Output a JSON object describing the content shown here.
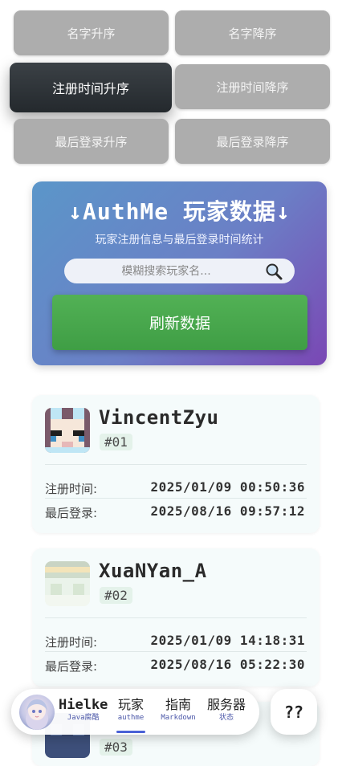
{
  "sort": {
    "name_asc": "名字升序",
    "name_desc": "名字降序",
    "reg_asc": "注册时间升序",
    "reg_desc": "注册时间降序",
    "login_asc": "最后登录升序",
    "login_desc": "最后登录降序"
  },
  "hero": {
    "title": "↓AuthMe 玩家数据↓",
    "subtitle": "玩家注册信息与最后登录时间统计",
    "search_placeholder": "模糊搜索玩家名...",
    "refresh_label": "刷新数据"
  },
  "players": [
    {
      "name": "VincentZyu",
      "rank": "#01",
      "reg_label": "注册时间:",
      "reg_value": "2025/01/09 00:50:36",
      "login_label": "最后登录:",
      "login_value": "2025/08/16 09:57:12"
    },
    {
      "name": "XuaNYan_A",
      "rank": "#02",
      "reg_label": "注册时间:",
      "reg_value": "2025/01/09 14:18:31",
      "login_label": "最后登录:",
      "login_value": "2025/08/16 05:22:30"
    },
    {
      "rank": "#03"
    }
  ],
  "nav": {
    "brand": "Hielke",
    "brand_sub": "Java腐酷",
    "items": [
      {
        "label": "玩家",
        "sub": "authme"
      },
      {
        "label": "指南",
        "sub": "Markdown"
      },
      {
        "label": "服务器",
        "sub": "状态"
      }
    ],
    "help": "??"
  }
}
